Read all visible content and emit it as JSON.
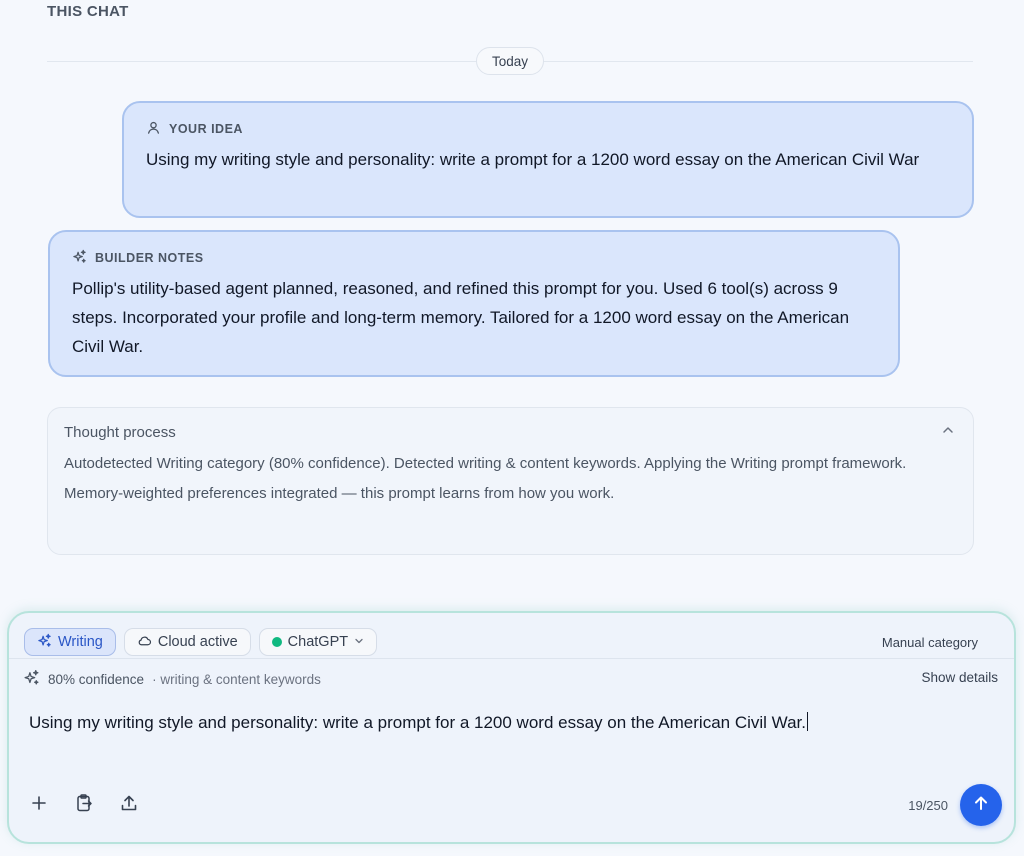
{
  "header": {
    "section_title": "THIS CHAT"
  },
  "divider": {
    "date_label": "Today"
  },
  "idea": {
    "label": "YOUR IDEA",
    "text": "Using my writing style and personality: write a prompt for a 1200 word essay on the American Civil War"
  },
  "notes": {
    "label": "BUILDER NOTES",
    "text": "Pollip's utility-based agent planned, reasoned, and refined this prompt for you. Used 6 tool(s) across 9 steps. Incorporated your profile and long-term memory. Tailored for a 1200 word essay on the American Civil War."
  },
  "thought": {
    "title": "Thought process",
    "line1": "Autodetected Writing category (80% confidence). Detected writing & content keywords. Applying the Writing prompt framework.",
    "line2": "Memory-weighted preferences integrated — this prompt learns from how you work."
  },
  "composer": {
    "chips": {
      "writing": "Writing",
      "cloud": "Cloud active",
      "model": "ChatGPT"
    },
    "manual_category": "Manual category",
    "confidence": "80% confidence",
    "confidence_detail": "· writing & content keywords",
    "show_details": "Show details",
    "input_value": "Using my writing style and personality: write a prompt for a 1200 word essay on the American Civil War.",
    "counter": "19/250"
  },
  "colors": {
    "accent": "#2563eb",
    "bubble_bg": "#dae6fc",
    "bubble_border": "#a9c3ef",
    "status_dot": "#10b981",
    "composer_border": "#b7e3dc"
  }
}
